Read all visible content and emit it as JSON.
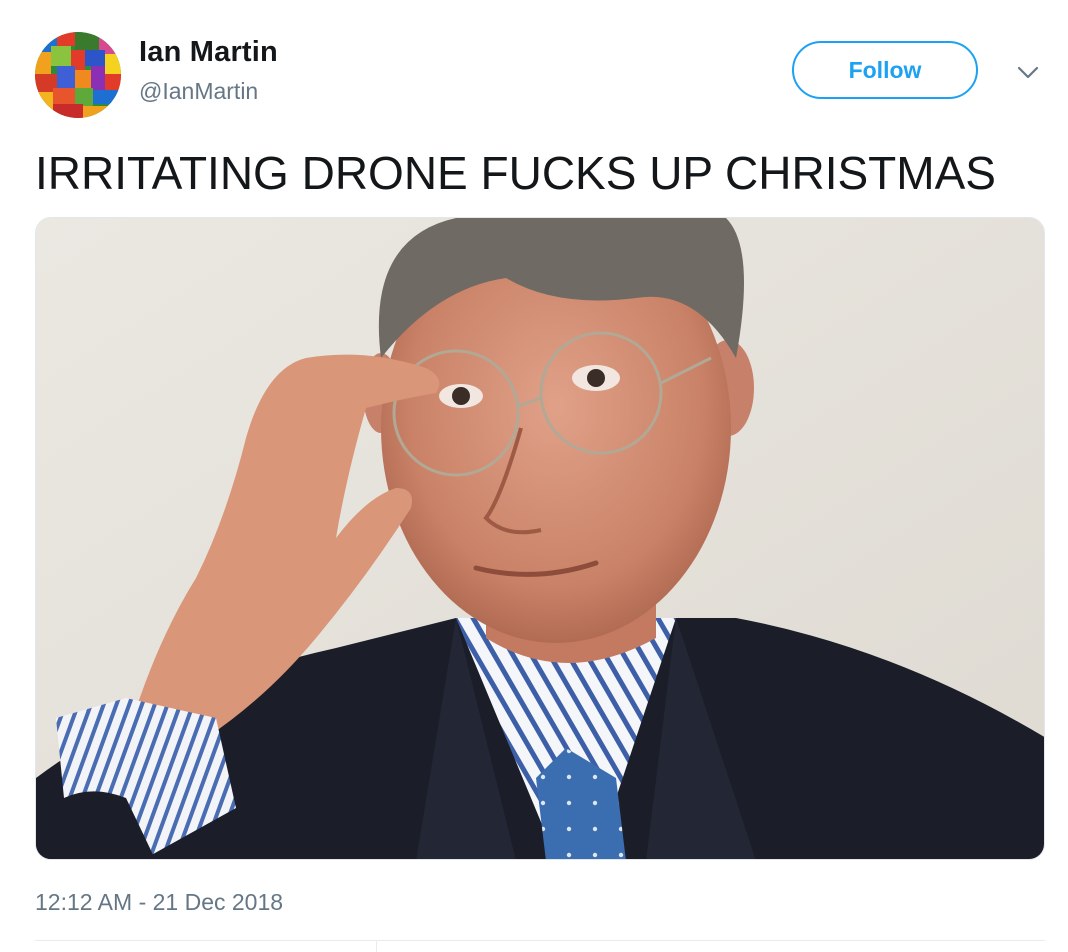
{
  "author": {
    "display_name": "Ian Martin",
    "handle": "@IanMartin"
  },
  "actions": {
    "follow_label": "Follow",
    "more_icon": "chevron-down-icon"
  },
  "tweet": {
    "text": "IRRITATING DRONE FUCKS UP CHRISTMAS",
    "timestamp": "12:12 AM - 21 Dec 2018"
  },
  "colors": {
    "accent": "#1da1f2",
    "secondary_text": "#657786",
    "primary_text": "#14171a"
  }
}
